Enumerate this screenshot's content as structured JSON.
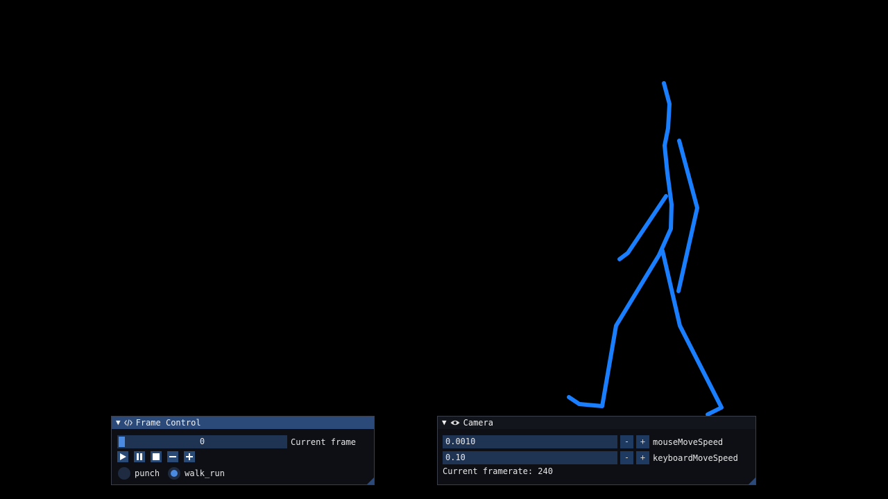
{
  "scene": {
    "figure_color": "#1a7fff"
  },
  "frame_control": {
    "title": "Frame Control",
    "frame_slider": {
      "value": "0",
      "label": "Current frame",
      "progress": 0
    },
    "buttons": {
      "play": "play-icon",
      "pause": "pause-icon",
      "stop": "stop-icon",
      "minus": "minus-icon",
      "plus": "plus-icon"
    },
    "animations": [
      {
        "label": "punch",
        "selected": false
      },
      {
        "label": "walk_run",
        "selected": true
      }
    ]
  },
  "camera": {
    "title": "Camera",
    "mouse_speed": {
      "value": "0.0010",
      "label": "mouseMoveSpeed",
      "minus": "-",
      "plus": "+"
    },
    "keyboard_speed": {
      "value": "0.10",
      "label": "keyboardMoveSpeed",
      "minus": "-",
      "plus": "+"
    },
    "framerate": "Current framerate: 240"
  },
  "colors": {
    "accent": "#4a8ae0",
    "title_active": "#2b4a7a",
    "frame_bg": "#1f3352"
  }
}
